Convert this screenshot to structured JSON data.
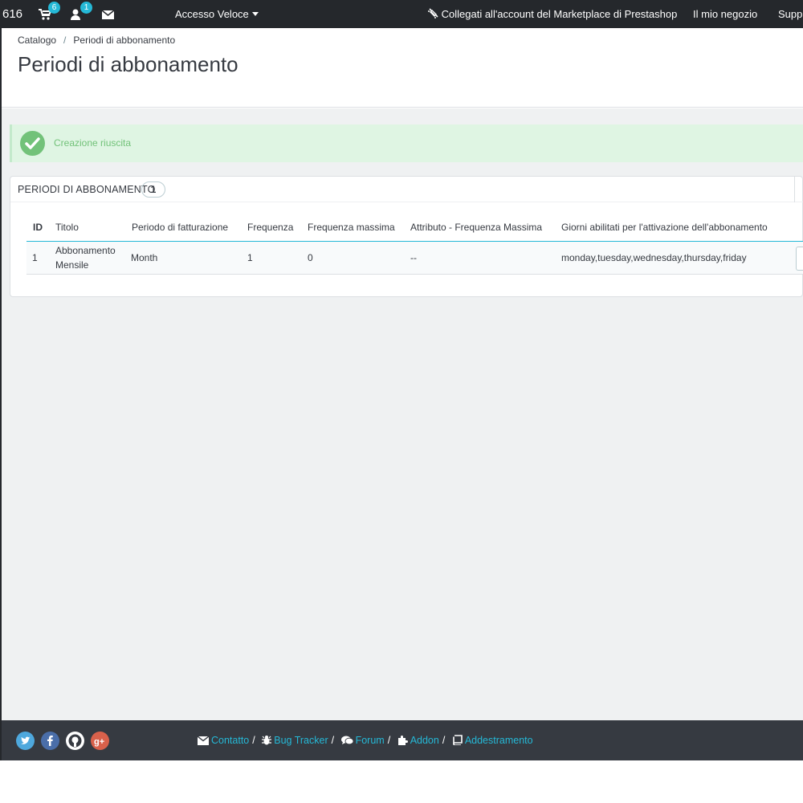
{
  "topbar": {
    "order_number": "616",
    "cart_badge": "6",
    "customer_badge": "1",
    "quick_access": "Accesso Veloce",
    "marketplace": "Collegati all'account del Marketplace di Prestashop",
    "my_shop": "Il mio negozio",
    "support": "Supp"
  },
  "breadcrumb": {
    "parent": "Catalogo",
    "separator": "/",
    "current": "Periodi di abbonamento"
  },
  "page_title": "Periodi di abbonamento",
  "alert": {
    "message": "Creazione riuscita"
  },
  "panel": {
    "title": "PERIODI DI ABBONAMENTO",
    "count": "1",
    "columns": [
      "ID",
      "Titolo",
      "Periodo di fatturazione",
      "Frequenza",
      "Frequenza massima",
      "Attributo - Frequenza Massima",
      "Giorni abilitati per l'attivazione dell'abbonamento"
    ],
    "rows": [
      {
        "id": "1",
        "title_line1": "Abbonamento",
        "title_line2": "Mensile",
        "billing_period": "Month",
        "frequency": "1",
        "max_frequency": "0",
        "attribute_max_frequency": "--",
        "enabled_days": "monday,tuesday,wednesday,thursday,friday"
      }
    ]
  },
  "footer": {
    "links": [
      "Contatto",
      "Bug Tracker",
      "Forum",
      "Addon",
      "Addestramento"
    ],
    "separator": "/"
  },
  "colors": {
    "topbar_bg": "#25282c",
    "accent": "#25b9d7",
    "success": "#72c279",
    "success_bg": "#dff5e3",
    "content_bg": "#eff1f2",
    "footer_bg": "#363a41"
  },
  "icons": [
    "cart-icon",
    "user-icon",
    "envelope-icon",
    "caret-down-icon",
    "puzzle-link-icon",
    "check-icon",
    "twitter-icon",
    "facebook-icon",
    "github-icon",
    "google-plus-icon",
    "bug-icon",
    "comments-icon",
    "book-icon"
  ]
}
